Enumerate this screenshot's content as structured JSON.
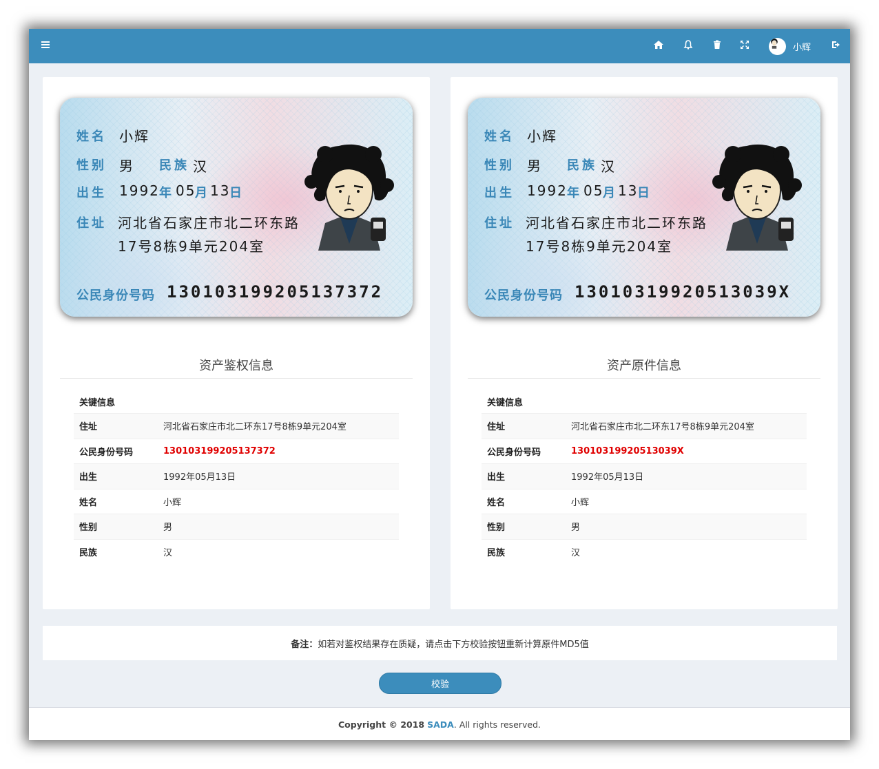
{
  "header": {
    "user_name": "小辉",
    "icons": [
      "menu-icon",
      "home-icon",
      "bell-icon",
      "trash-icon",
      "fullscreen-icon",
      "avatar",
      "logout-icon"
    ]
  },
  "cards": [
    {
      "card": {
        "name_label": "姓名",
        "name": "小辉",
        "gender_label": "性别",
        "gender": "男",
        "ethnic_label": "民族",
        "ethnic": "汉",
        "birth_label": "出生",
        "birth_year": "1992",
        "year_char": "年",
        "birth_month": "05",
        "month_char": "月",
        "birth_day": "13",
        "day_char": "日",
        "addr_label": "住址",
        "addr_line1": "河北省石家庄市北二环东路",
        "addr_line2": "17号8栋9单元204室",
        "id_label": "公民身份号码",
        "id_number": "130103199205137372"
      },
      "section_title": "资产鉴权信息",
      "key_title": "关键信息",
      "rows": [
        {
          "k": "住址",
          "v": "河北省石家庄市北二环东17号8栋9单元204室"
        },
        {
          "k": "公民身份号码",
          "v": "130103199205137372"
        },
        {
          "k": "出生",
          "v": "1992年05月13日"
        },
        {
          "k": "姓名",
          "v": "小辉"
        },
        {
          "k": "性别",
          "v": "男"
        },
        {
          "k": "民族",
          "v": "汉"
        }
      ]
    },
    {
      "card": {
        "name_label": "姓名",
        "name": "小辉",
        "gender_label": "性别",
        "gender": "男",
        "ethnic_label": "民族",
        "ethnic": "汉",
        "birth_label": "出生",
        "birth_year": "1992",
        "year_char": "年",
        "birth_month": "05",
        "month_char": "月",
        "birth_day": "13",
        "day_char": "日",
        "addr_label": "住址",
        "addr_line1": "河北省石家庄市北二环东路",
        "addr_line2": "17号8栋9单元204室",
        "id_label": "公民身份号码",
        "id_number": "13010319920513039X"
      },
      "section_title": "资产原件信息",
      "key_title": "关键信息",
      "rows": [
        {
          "k": "住址",
          "v": "河北省石家庄市北二环东17号8栋9单元204室"
        },
        {
          "k": "公民身份号码",
          "v": "13010319920513039X"
        },
        {
          "k": "出生",
          "v": "1992年05月13日"
        },
        {
          "k": "姓名",
          "v": "小辉"
        },
        {
          "k": "性别",
          "v": "男"
        },
        {
          "k": "民族",
          "v": "汉"
        }
      ]
    }
  ],
  "highlight_color": "#e00000",
  "note": {
    "label": "备注：",
    "text": "如若对鉴权结果存在质疑，请点击下方校验按钮重新计算原件MD5值"
  },
  "verify_button": "校验",
  "footer": {
    "copyright": "Copyright © 2018",
    "brand": "SADA",
    "rest": ". All rights reserved."
  }
}
